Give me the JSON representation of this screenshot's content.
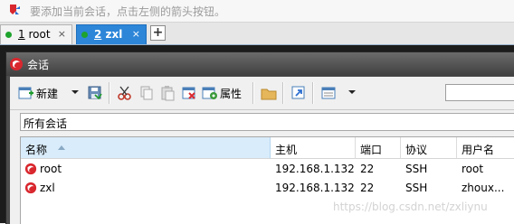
{
  "hint": {
    "text": "要添加当前会话，点击左侧的箭头按钮。"
  },
  "tabs": [
    {
      "num": "1",
      "name": "root",
      "close": "×"
    },
    {
      "num": "2",
      "name": "zxl",
      "close": "×"
    }
  ],
  "add_tab": "+",
  "dialog": {
    "title": "会话"
  },
  "toolbar": {
    "new_label": "新建",
    "properties_label": "属性",
    "search_value": ""
  },
  "path": "所有会话",
  "table": {
    "headers": [
      "名称",
      "主机",
      "端口",
      "协议",
      "用户名"
    ],
    "rows": [
      {
        "name": "root",
        "host": "192.168.1.132",
        "port": "22",
        "protocol": "SSH",
        "user": "root"
      },
      {
        "name": "zxl",
        "host": "192.168.1.132",
        "port": "22",
        "protocol": "SSH",
        "user": "zhoux..."
      }
    ]
  },
  "watermark": "https://blog.csdn.net/zxliynu",
  "colors": {
    "active_tab": "#2d86d8",
    "status_dot": "#1ea32d",
    "brand_red": "#d9272e"
  }
}
